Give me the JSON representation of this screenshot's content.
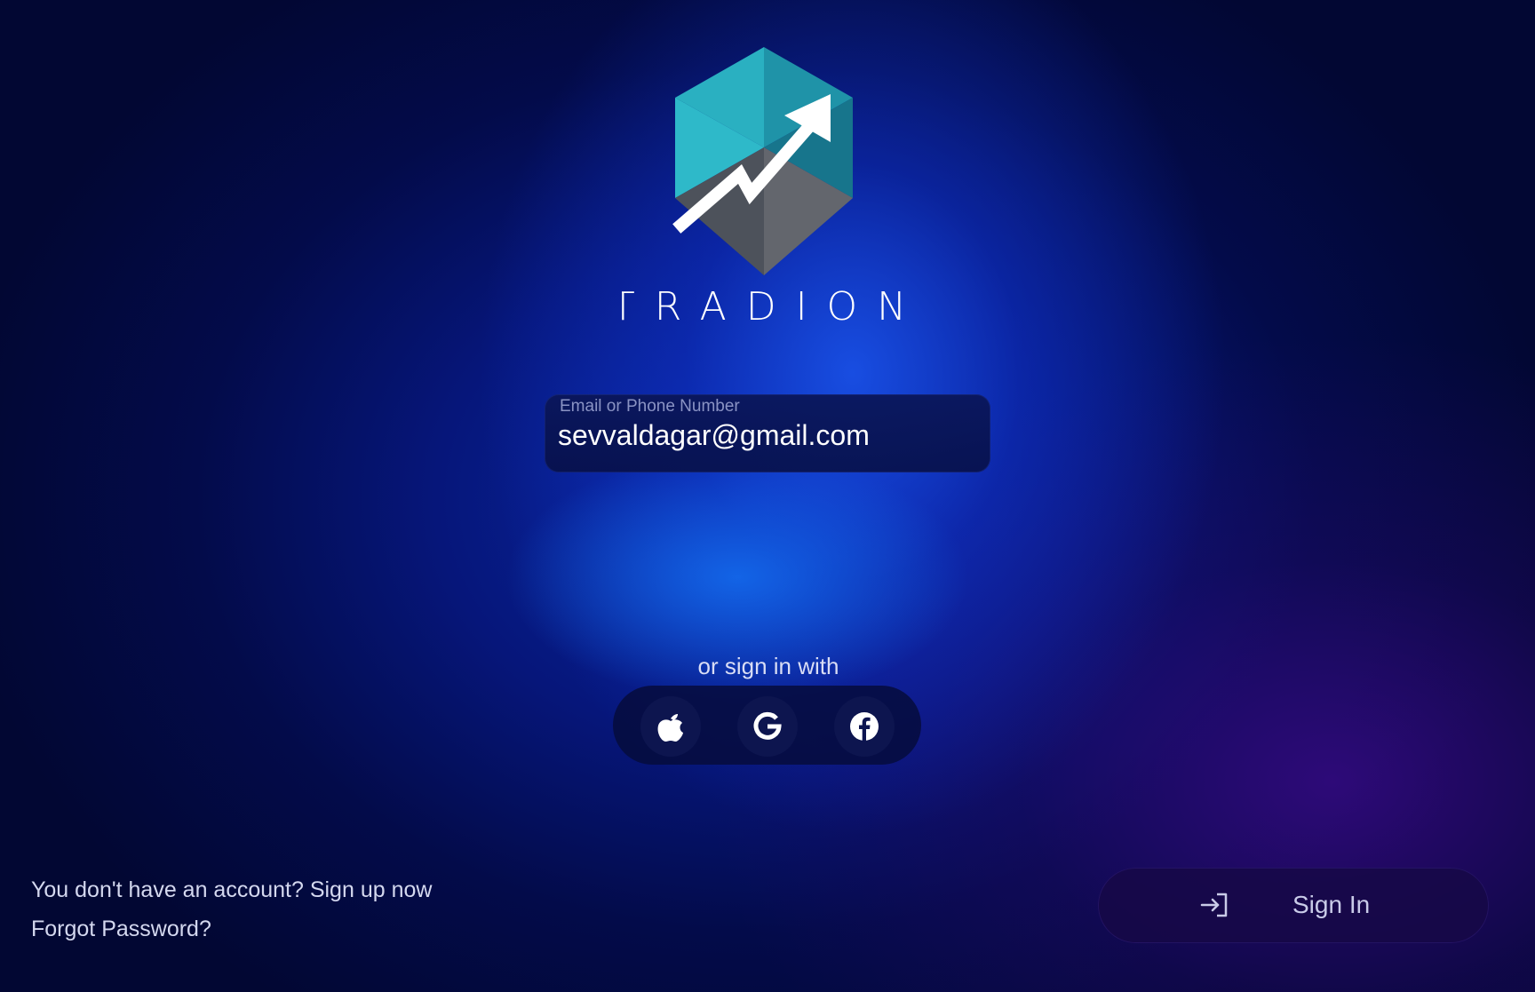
{
  "brand": {
    "name": "TRADION",
    "logo_icon": "hexagon-trend-up-arrow",
    "colors": {
      "hex_top_left": "#2db6c6",
      "hex_top_right": "#1a7f95",
      "hex_bottom": "#5a5d66",
      "arrow": "#ffffff"
    }
  },
  "login_form": {
    "email_field": {
      "label": "Email or Phone Number",
      "value": "sevvaldagar@gmail.com"
    }
  },
  "social_login": {
    "caption": "or sign in with",
    "providers": [
      {
        "name": "Apple",
        "icon": "apple-icon"
      },
      {
        "name": "Google",
        "icon": "google-icon"
      },
      {
        "name": "Facebook",
        "icon": "facebook-icon"
      }
    ]
  },
  "links": {
    "signup": "You don't have an account? Sign up now",
    "forgot_password": "Forgot Password?"
  },
  "signin_button": {
    "label": "Sign In",
    "icon": "login-arrow-icon"
  },
  "theme": {
    "background_dark": "#020733",
    "background_glow": "#1450e6",
    "accent_purple": "#2a0a70",
    "text_muted": "#d4d8ef"
  }
}
